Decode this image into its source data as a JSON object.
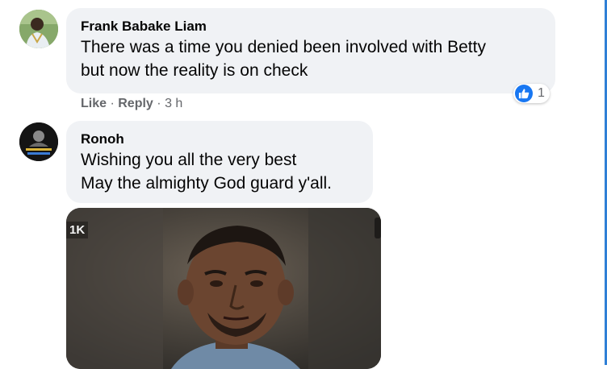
{
  "comments": [
    {
      "author": "Frank Babake Liam",
      "lines": [
        "There was a time you denied been involved with Betty",
        "but now the reality is on check"
      ],
      "like_label": "Like",
      "reply_label": "Reply",
      "separator": "·",
      "time": "3 h",
      "reaction_count": "1"
    },
    {
      "author": "Ronoh",
      "lines": [
        "Wishing you all the very best",
        "May the almighty God guard y'all."
      ],
      "avatar_text": [
        "COMPLETING",
        "THE JOURNEY"
      ]
    }
  ],
  "attachment": {
    "badge": "1K"
  },
  "colors": {
    "bubble": "#f0f2f5",
    "meta": "#65676b",
    "like_blue": "#1877f2",
    "edge": "#2f80d6"
  }
}
